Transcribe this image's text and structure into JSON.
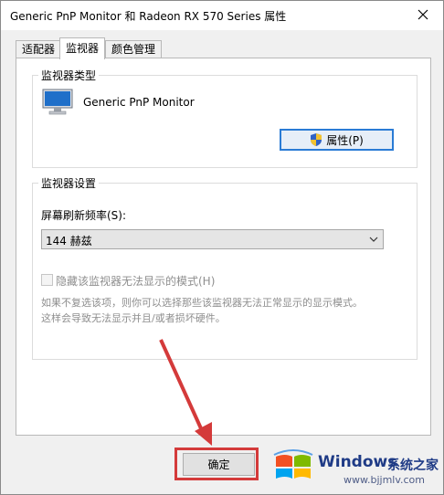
{
  "window": {
    "title": "Generic PnP Monitor 和 Radeon RX 570 Series 属性"
  },
  "tabs": [
    {
      "label": "适配器"
    },
    {
      "label": "监视器"
    },
    {
      "label": "颜色管理"
    }
  ],
  "active_tab": "监视器",
  "monitor_type": {
    "legend": "监视器类型",
    "monitor_name": "Generic PnP Monitor",
    "properties_label": "属性(P)"
  },
  "monitor_settings": {
    "legend": "监视器设置",
    "refresh_label": "屏幕刷新频率(S):",
    "refresh_value": "144 赫兹",
    "hide_modes_label": "隐藏该监视器无法显示的模式(H)",
    "hide_modes_checked": false,
    "description_line1": "如果不复选该项，则你可以选择那些该监视器无法正常显示的显示模式。",
    "description_line2": "这样会导致无法显示并且/或者损坏硬件。"
  },
  "footer": {
    "ok_label": "确定"
  },
  "watermark": {
    "brand": "Windows",
    "brand_cn": "系统之家",
    "url": "www.bjjmlv.com"
  },
  "colors": {
    "annotation_red": "#d43a3a",
    "button_focus": "#2a7bd5",
    "watermark_blue": "#1f3b86"
  }
}
